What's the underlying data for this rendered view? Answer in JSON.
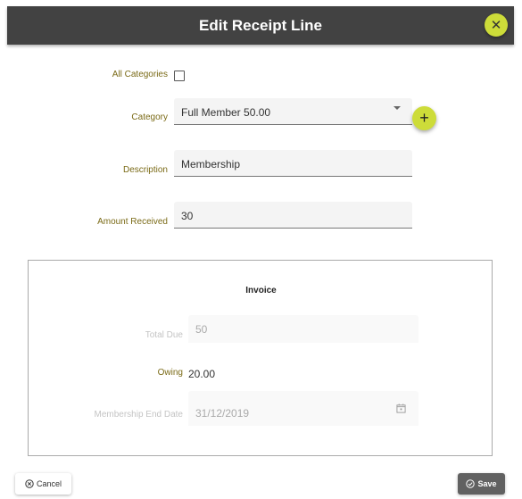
{
  "dialog": {
    "title": "Edit Receipt Line",
    "close_icon": "close-icon"
  },
  "form": {
    "all_categories": {
      "label": "All Categories",
      "checked": false
    },
    "category": {
      "label": "Category",
      "value": "Full Member 50.00",
      "add_icon": "plus-icon"
    },
    "description": {
      "label": "Description",
      "value": "Membership"
    },
    "amount_received": {
      "label": "Amount Received",
      "value": "30"
    }
  },
  "invoice": {
    "title": "Invoice",
    "total_due": {
      "label": "Total Due",
      "value": "50"
    },
    "owing": {
      "label": "Owing",
      "value": "20.00"
    },
    "membership_end_date": {
      "label": "Membership End Date",
      "value": "31/12/2019",
      "icon": "calendar-icon"
    }
  },
  "footer": {
    "cancel_label": "Cancel",
    "save_label": "Save"
  },
  "colors": {
    "accent": "#cddc39",
    "header": "#424242",
    "label": "#7a6a16"
  }
}
